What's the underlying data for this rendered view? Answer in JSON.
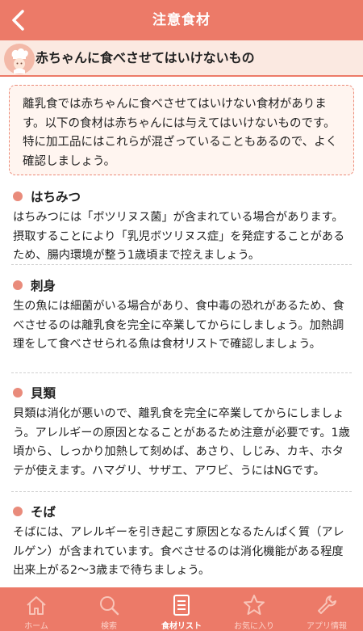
{
  "header": {
    "title": "注意食材"
  },
  "section": {
    "title": "赤ちゃんに食べさせてはいけないもの"
  },
  "intro": "離乳食では赤ちゃんに食べさせてはいけない食材があります。以下の食材は赤ちゃんには与えてはいけないものです。特に加工品にはこれらが混ざっていることもあるので、よく確認しましょう。",
  "items": [
    {
      "title": "はちみつ",
      "text": "はちみつには「ボツリヌス菌」が含まれている場合があります。摂取することにより「乳児ボツリヌス症」を発症することがあるため、腸内環境が整う1歳頃まで控えましょう。"
    },
    {
      "title": "刺身",
      "text": "生の魚には細菌がいる場合があり、食中毒の恐れがあるため、食べさせるのは離乳食を完全に卒業してからにしましょう。加熱調理をして食べさせられる魚は食材リストで確認しましょう。"
    },
    {
      "title": "貝類",
      "text": "貝類は消化が悪いので、離乳食を完全に卒業してからにしましょう。アレルギーの原因となることがあるため注意が必要です。1歳頃から、しっかり加熱して刻めば、あさり、しじみ、カキ、ホタテが使えます。ハマグリ、サザエ、アワビ、うにはNGです。"
    },
    {
      "title": "そば",
      "text": "そばには、アレルギーを引き起こす原因となるたんぱく質（アレルゲン）が含まれています。食べさせるのは消化機能がある程度出来上がる2〜3歳まで待ちましょう。"
    }
  ],
  "tabs": [
    {
      "label": "ホーム",
      "icon": "home-icon",
      "active": false
    },
    {
      "label": "検索",
      "icon": "search-icon",
      "active": false
    },
    {
      "label": "食材リスト",
      "icon": "list-icon",
      "active": true
    },
    {
      "label": "お気に入り",
      "icon": "star-icon",
      "active": false
    },
    {
      "label": "アプリ情報",
      "icon": "wrench-icon",
      "active": false
    }
  ],
  "colors": {
    "accent": "#ec7a68",
    "section_bg": "#fbe9e1",
    "intro_bg": "#fff5f0",
    "bullet": "#e98b7b"
  }
}
